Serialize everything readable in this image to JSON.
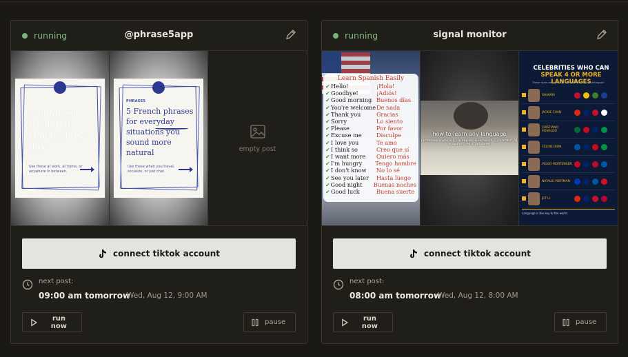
{
  "cards": [
    {
      "status": "running",
      "title": "@phrase5app",
      "posts": {
        "slide1_text": "5 phrases I tried that changed my day",
        "slide1_small": "Use these at work, at home, or anywhere in between.",
        "slide2_kicker": "PHRASES",
        "slide2_head": "5 French phrases for everyday situations you sound more natural",
        "slide2_small": "Use these when you travel, socialize, or just chat.",
        "empty_label": "empty post"
      },
      "connect_label": "connect tiktok account",
      "next_label": "next post:",
      "next_time": "09:00 am tomorrow",
      "next_date": "Wed, Aug 12, 9:00 AM",
      "run_label": "run now",
      "pause_label": "pause"
    },
    {
      "status": "running",
      "title": "signal monitor",
      "posts": {
        "spanish_title": "Learn Spanish Easily",
        "spanish_rows": [
          {
            "en": "Hello!",
            "es": "¡Hola!"
          },
          {
            "en": "Goodbye!",
            "es": "¡Adiós!"
          },
          {
            "en": "Good morning",
            "es": "Buenos días"
          },
          {
            "en": "You're welcome",
            "es": "De nada"
          },
          {
            "en": "Thank you",
            "es": "Gracias"
          },
          {
            "en": "Sorry",
            "es": "Lo siento"
          },
          {
            "en": "Please",
            "es": "Por favor"
          },
          {
            "en": "Excuse me",
            "es": "Disculpe"
          },
          {
            "en": "I love you",
            "es": "Te amo"
          },
          {
            "en": "I think so",
            "es": "Creo que sí"
          },
          {
            "en": "I want more",
            "es": "Quiero más"
          },
          {
            "en": "I'm hungry",
            "es": "Tengo hambre"
          },
          {
            "en": "I don't know",
            "es": "No lo sé"
          },
          {
            "en": "See you later",
            "es": "Hasta luego"
          },
          {
            "en": "Good night",
            "es": "Buenas noches"
          },
          {
            "en": "Good luck",
            "es": "Buena suerte"
          }
        ],
        "video_caption": "how to learn any language",
        "video_sub": "(as someone who is C1 in english, B2+ french, C2+ arabic, A1 in spanish, A0 in japanese)",
        "celeb_title_a": "CELEBRITIES WHO CAN",
        "celeb_title_b": "SPEAK 4 OR MORE LANGUAGES",
        "celeb_sub": "These stars are not only talented but also multilingual!",
        "celeb_names": [
          "SHAKIRA",
          "JACKIE CHAN",
          "CRISTIANO RONALDO",
          "CÉLINE DION",
          "VIGGO MORTENSEN",
          "NATALIE PORTMAN",
          "JET LI"
        ],
        "celeb_foot": "Language is the key to the world."
      },
      "connect_label": "connect tiktok account",
      "next_label": "next post:",
      "next_time": "08:00 am tomorrow",
      "next_date": "Wed, Aug 12, 8:00 AM",
      "run_label": "run now",
      "pause_label": "pause"
    }
  ],
  "colors": {
    "running": "#7fba82",
    "background": "#1b1914",
    "card": "#201e18",
    "connect_bg": "#e5e3de"
  },
  "icons": [
    "pencil-icon",
    "image-icon",
    "tiktok-icon",
    "clock-icon",
    "play-icon",
    "pause-icon"
  ]
}
